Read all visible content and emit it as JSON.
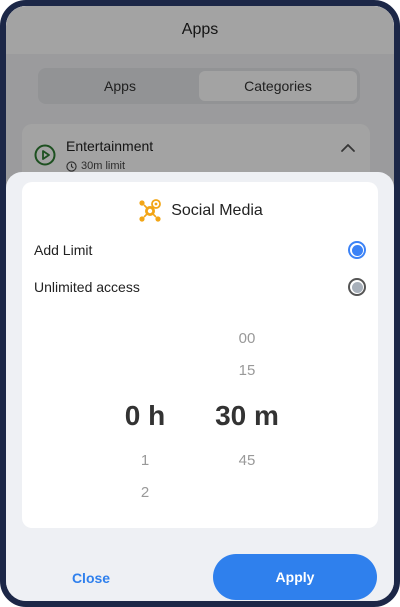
{
  "background": {
    "header_title": "Apps",
    "segments": [
      {
        "label": "Apps",
        "active": false
      },
      {
        "label": "Categories",
        "active": true
      }
    ],
    "category_card": {
      "title": "Entertainment",
      "subtitle": "30m limit",
      "icon": "play-circle-icon",
      "accent": "#2e7d32"
    }
  },
  "sheet": {
    "title": "Social Media",
    "title_icon": "social-media-icon",
    "options": [
      {
        "label": "Add Limit",
        "selected": true
      },
      {
        "label": "Unlimited access",
        "selected": false
      }
    ],
    "picker": {
      "hours": {
        "selected": "0",
        "unit": "h",
        "below": [
          "1",
          "2"
        ]
      },
      "minutes": {
        "above": [
          "00",
          "15"
        ],
        "selected": "30",
        "unit": "m",
        "below": [
          "45"
        ]
      }
    },
    "close_label": "Close",
    "apply_label": "Apply",
    "accent": "#2f80ed"
  }
}
